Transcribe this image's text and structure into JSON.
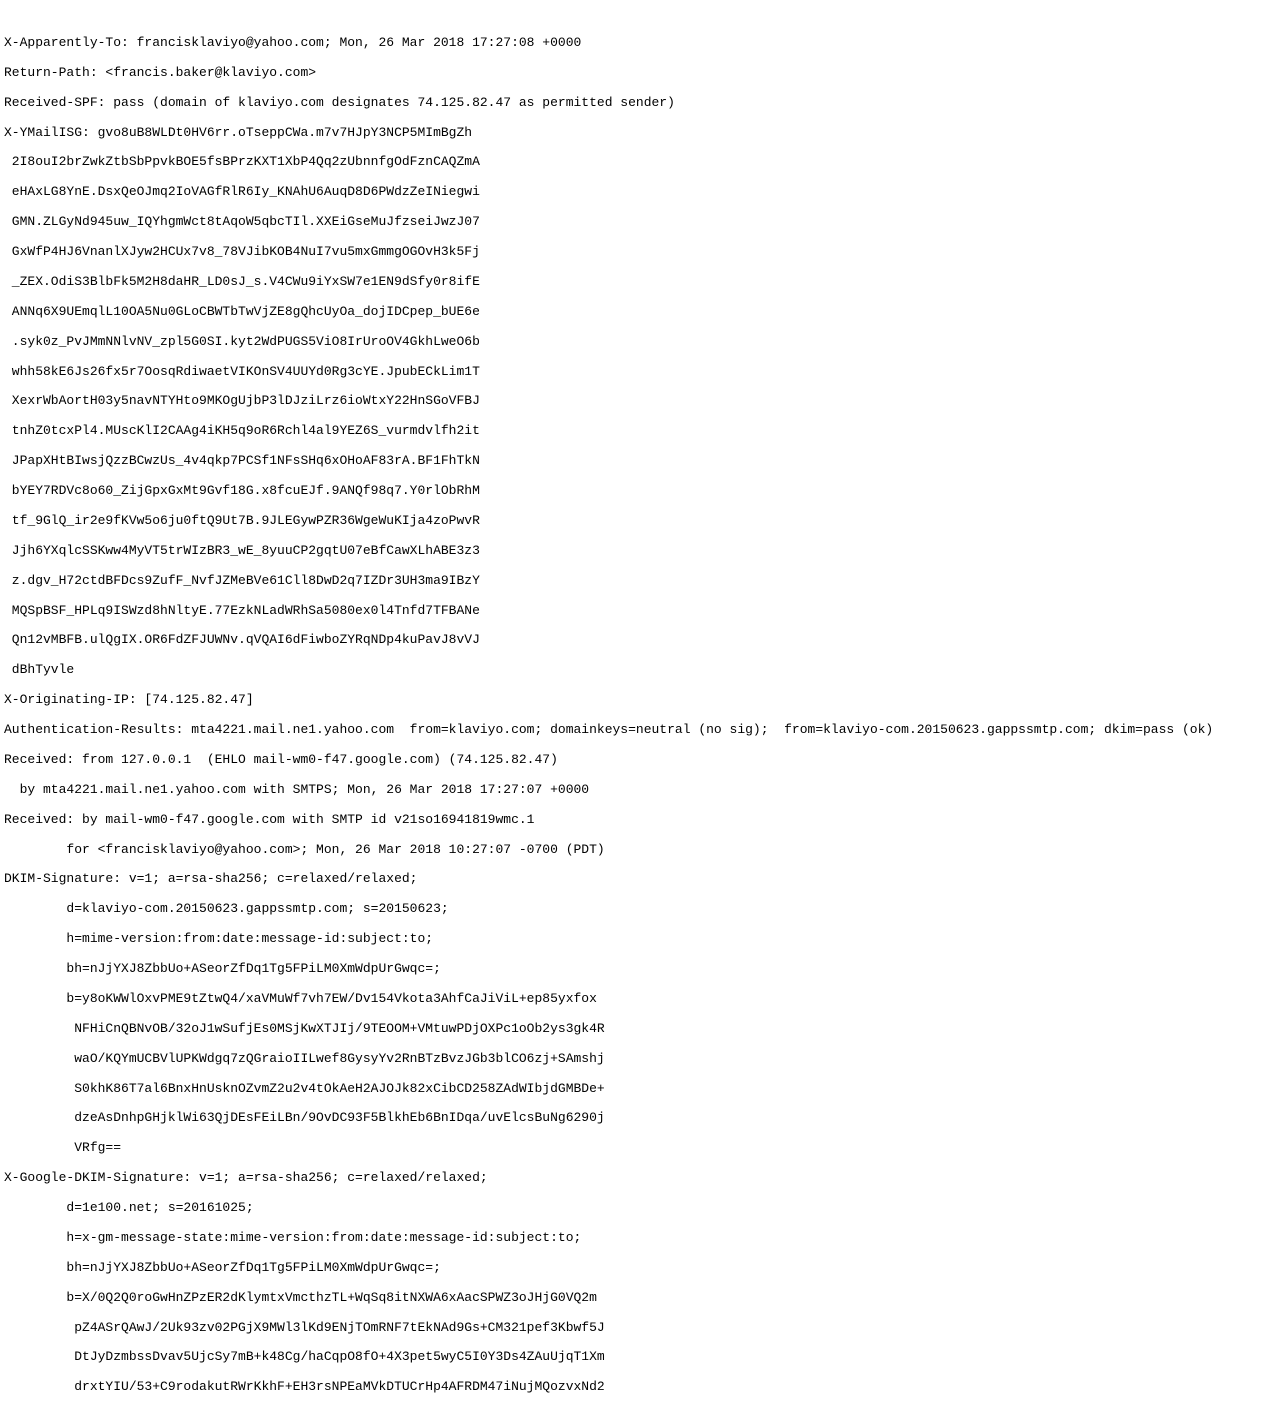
{
  "headers": {
    "x_apparently_to": "X-Apparently-To: francisklaviyo@yahoo.com; Mon, 26 Mar 2018 17:27:08 +0000",
    "return_path": "Return-Path: <francis.baker@klaviyo.com>",
    "received_spf": "Received-SPF: pass (domain of klaviyo.com designates 74.125.82.47 as permitted sender)",
    "x_ymailisg_start": "X-YMailISG: gvo8uB8WLDt0HV6rr.oTseppCWa.m7v7HJpY3NCP5MImBgZh",
    "ymailisg_01": " 2I8ouI2brZwkZtbSbPpvkBOE5fsBPrzKXT1XbP4Qq2zUbnnfgOdFznCAQZmA",
    "ymailisg_02": " eHAxLG8YnE.DsxQeOJmq2IoVAGfRlR6Iy_KNAhU6AuqD8D6PWdzZeINiegwi",
    "ymailisg_03": " GMN.ZLGyNd945uw_IQYhgmWct8tAqoW5qbcTIl.XXEiGseMuJfzseiJwzJ07",
    "ymailisg_04": " GxWfP4HJ6VnanlXJyw2HCUx7v8_78VJibKOB4NuI7vu5mxGmmgOGOvH3k5Fj",
    "ymailisg_05": " _ZEX.OdiS3BlbFk5M2H8daHR_LD0sJ_s.V4CWu9iYxSW7e1EN9dSfy0r8ifE",
    "ymailisg_06": " ANNq6X9UEmqlL10OA5Nu0GLoCBWTbTwVjZE8gQhcUyOa_dojIDCpep_bUE6e",
    "ymailisg_07": " .syk0z_PvJMmNNlvNV_zpl5G0SI.kyt2WdPUGS5ViO8IrUroOV4GkhLweO6b",
    "ymailisg_08": " whh58kE6Js26fx5r7OosqRdiwaetVIKOnSV4UUYd0Rg3cYE.JpubECkLim1T",
    "ymailisg_09": " XexrWbAortH03y5navNTYHto9MKOgUjbP3lDJziLrz6ioWtxY22HnSGoVFBJ",
    "ymailisg_10": " tnhZ0tcxPl4.MUscKlI2CAAg4iKH5q9oR6Rchl4al9YEZ6S_vurmdvlfh2it",
    "ymailisg_11": " JPapXHtBIwsjQzzBCwzUs_4v4qkp7PCSf1NFsSHq6xOHoAF83rA.BF1FhTkN",
    "ymailisg_12": " bYEY7RDVc8o60_ZijGpxGxMt9Gvf18G.x8fcuEJf.9ANQf98q7.Y0rlObRhM",
    "ymailisg_13": " tf_9GlQ_ir2e9fKVw5o6ju0ftQ9Ut7B.9JLEGywPZR36WgeWuKIja4zoPwvR",
    "ymailisg_14": " Jjh6YXqlcSSKww4MyVT5trWIzBR3_wE_8yuuCP2gqtU07eBfCawXLhABE3z3",
    "ymailisg_15": " z.dgv_H72ctdBFDcs9ZufF_NvfJZMeBVe61Cll8DwD2q7IZDr3UH3ma9IBzY",
    "ymailisg_16": " MQSpBSF_HPLq9ISWzd8hNltyE.77EzkNLadWRhSa5080ex0l4Tnfd7TFBANe",
    "ymailisg_17": " Qn12vMBFB.ulQgIX.OR6FdZFJUWNv.qVQAI6dFiwboZYRqNDp4kuPavJ8vVJ",
    "ymailisg_18": " dBhTyvle",
    "x_originating_ip": "X-Originating-IP: [74.125.82.47]",
    "authentication_results": "Authentication-Results: mta4221.mail.ne1.yahoo.com  from=klaviyo.com; domainkeys=neutral (no sig);  from=klaviyo-com.20150623.gappssmtp.com; dkim=pass (ok)",
    "received_1a": "Received: from 127.0.0.1  (EHLO mail-wm0-f47.google.com) (74.125.82.47)",
    "received_1b": "  by mta4221.mail.ne1.yahoo.com with SMTPS; Mon, 26 Mar 2018 17:27:07 +0000",
    "received_2a": "Received: by mail-wm0-f47.google.com with SMTP id v21so16941819wmc.1",
    "received_2b": "        for <francisklaviyo@yahoo.com>; Mon, 26 Mar 2018 10:27:07 -0700 (PDT)",
    "dkim_start": "DKIM-Signature: v=1; a=rsa-sha256; c=relaxed/relaxed;",
    "dkim_01": "        d=klaviyo-com.20150623.gappssmtp.com; s=20150623;",
    "dkim_02": "        h=mime-version:from:date:message-id:subject:to;",
    "dkim_03": "        bh=nJjYXJ8ZbbUo+ASeorZfDq1Tg5FPiLM0XmWdpUrGwqc=;",
    "dkim_04": "        b=y8oKWWlOxvPME9tZtwQ4/xaVMuWf7vh7EW/Dv154Vkota3AhfCaJiViL+ep85yxfox",
    "dkim_05": "         NFHiCnQBNvOB/32oJ1wSufjEs0MSjKwXTJIj/9TEOOM+VMtuwPDjOXPc1oOb2ys3gk4R",
    "dkim_06": "         waO/KQYmUCBVlUPKWdgq7zQGraioIILwef8GysyYv2RnBTzBvzJGb3blCO6zj+SAmshj",
    "dkim_07": "         S0khK86T7al6BnxHnUsknOZvmZ2u2v4tOkAeH2AJOJk82xCibCD258ZAdWIbjdGMBDe+",
    "dkim_08": "         dzeAsDnhpGHjklWi63QjDEsFEiLBn/9OvDC93F5BlkhEb6BnIDqa/uvElcsBuNg6290j",
    "dkim_09": "         VRfg==",
    "google_dkim_start": "X-Google-DKIM-Signature: v=1; a=rsa-sha256; c=relaxed/relaxed;",
    "google_dkim_01": "        d=1e100.net; s=20161025;",
    "google_dkim_02": "        h=x-gm-message-state:mime-version:from:date:message-id:subject:to;",
    "google_dkim_03": "        bh=nJjYXJ8ZbbUo+ASeorZfDq1Tg5FPiLM0XmWdpUrGwqc=;",
    "google_dkim_04": "        b=X/0Q2Q0roGwHnZPzER2dKlymtxVmcthzTL+WqSq8itNXWA6xAacSPWZ3oJHjG0VQ2m",
    "google_dkim_05": "         pZ4ASrQAwJ/2Uk93zv02PGjX9MWl3lKd9ENjTOmRNF7tEkNAd9Gs+CM321pef3Kbwf5J",
    "google_dkim_06": "         DtJyDzmbssDvav5UjcSy7mB+k48Cg/haCqpO8fO+4X3pet5wyC5I0Y3Ds4ZAuUjqT1Xm",
    "google_dkim_07": "         drxtYIU/53+C9rodakutRWrKkhF+EH3rsNPEaMVkDTUCrHp4AFRDM47iNujMQozvxNd2"
  }
}
